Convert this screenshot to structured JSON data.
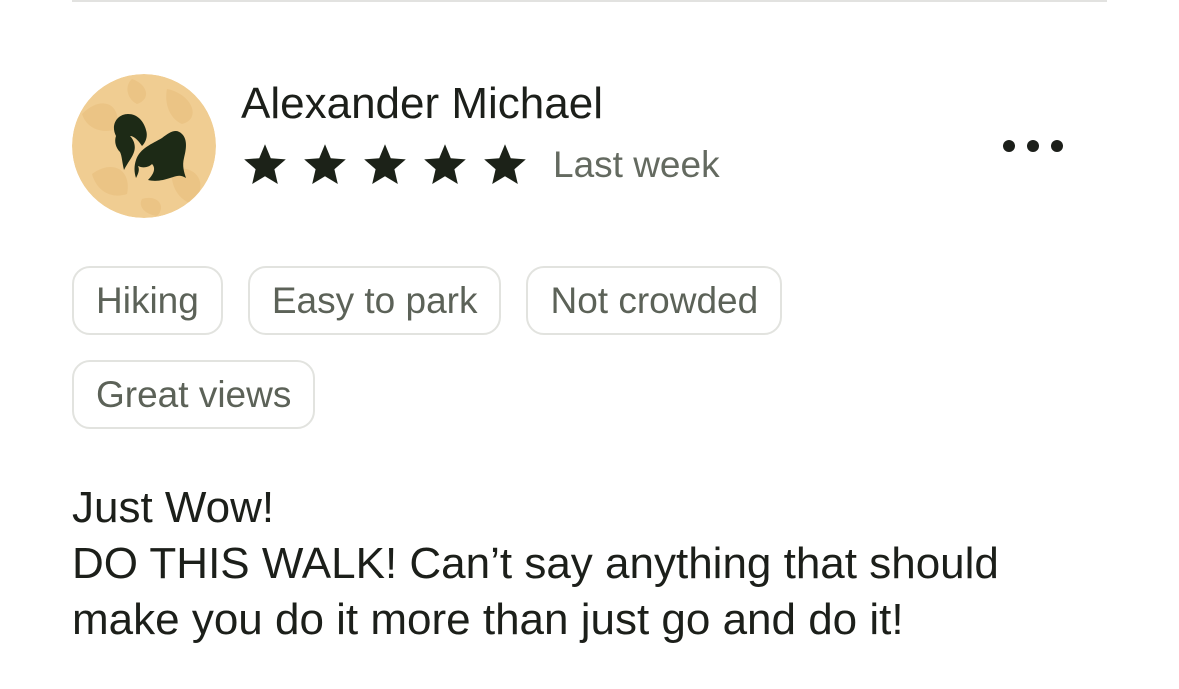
{
  "review": {
    "author_name": "Alexander Michael",
    "avatar_icon": "avatar-icon",
    "rating": 5,
    "rating_max": 5,
    "date": "Last week",
    "more_icon": "more-horizontal-icon",
    "tags": [
      "Hiking",
      "Easy to park",
      "Not crowded",
      "Great views"
    ],
    "body_lines": [
      "Just Wow!",
      "DO THIS WALK! Can’t say anything that should",
      "make you do it more than just go and do it!"
    ]
  },
  "colors": {
    "text_primary": "#1c1f1a",
    "text_secondary": "#646a60",
    "star": "#1c2218",
    "avatar_background": "#f0cd92",
    "avatar_glyph": "#1d2a16",
    "tag_border": "#e2e3df"
  }
}
